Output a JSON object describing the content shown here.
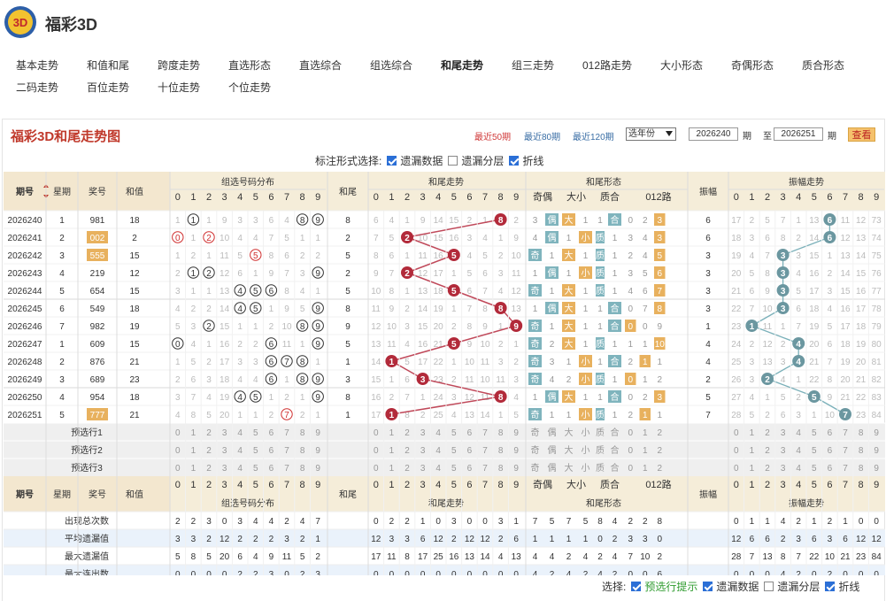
{
  "site": {
    "title": "福彩3D"
  },
  "nav": {
    "row1": [
      "基本走势",
      "和值和尾",
      "跨度走势",
      "直选形态",
      "直选综合",
      "组选综合",
      "和尾走势",
      "组三走势",
      "012路走势",
      "大小形态",
      "奇偶形态",
      "质合形态"
    ],
    "row2": [
      "二码走势",
      "百位走势",
      "十位走势",
      "个位走势"
    ],
    "active": "和尾走势"
  },
  "chart": {
    "title": "福彩3D和尾走势图",
    "ranges": [
      "最近50期",
      "最近80期",
      "最近120期"
    ],
    "selected_range": "最近50期",
    "year_select": "选年份",
    "start_period": "2026240",
    "end_period": "2026251",
    "label_qi": "期",
    "label_zhi": "至",
    "query": "查看"
  },
  "marking": {
    "label": "标注形式选择:",
    "options": [
      {
        "label": "遗漏数据",
        "checked": true
      },
      {
        "label": "遗漏分层",
        "checked": false
      },
      {
        "label": "折线",
        "checked": true
      }
    ]
  },
  "headers": {
    "period": "期号",
    "weekday": "星期",
    "prize": "奖号",
    "sum": "和值",
    "group_dist": "组选号码分布",
    "tail": "和尾",
    "tail_trend": "和尾走势",
    "tail_form": "和尾形态",
    "amp": "振幅",
    "amp_trend": "振幅走势",
    "form_sub": [
      "奇偶",
      "大小",
      "质合",
      "012路"
    ],
    "digits": [
      "0",
      "1",
      "2",
      "3",
      "4",
      "5",
      "6",
      "7",
      "8",
      "9"
    ]
  },
  "rows": [
    {
      "p": "2026240",
      "w": "1",
      "n": "981",
      "s": "18",
      "hit": false,
      "dist": [
        "1",
        "①",
        "1",
        "9",
        "3",
        "3",
        "6",
        "4",
        "⑧",
        "⑨"
      ],
      "t": "8",
      "tt": [
        "6",
        "4",
        "1",
        "9",
        "14",
        "15",
        "2",
        "1",
        "8",
        "2"
      ],
      "oe": [
        "3",
        "偶"
      ],
      "bs": [
        "大",
        "1"
      ],
      "pc": [
        "1",
        "合"
      ],
      "r012": [
        "0",
        "2",
        "3",
        "2"
      ],
      "a": "6",
      "at": [
        "17",
        "2",
        "5",
        "7",
        "1",
        "13",
        "6",
        "11",
        "12",
        "73"
      ]
    },
    {
      "p": "2026241",
      "w": "2",
      "n": "002",
      "s": "2",
      "hit": true,
      "dist": [
        "⓪",
        "1",
        "②",
        "10",
        "4",
        "4",
        "7",
        "5",
        "1",
        "1"
      ],
      "t": "2",
      "tt": [
        "7",
        "5",
        "2",
        "10",
        "15",
        "16",
        "3",
        "4",
        "1",
        "9"
      ],
      "oe": [
        "4",
        "偶"
      ],
      "bs": [
        "1",
        "小"
      ],
      "pc": [
        "质",
        "1"
      ],
      "r012": [
        "3",
        "4",
        "3",
        "2"
      ],
      "a": "6",
      "at": [
        "18",
        "3",
        "6",
        "8",
        "2",
        "14",
        "6",
        "12",
        "13",
        "74"
      ]
    },
    {
      "p": "2026242",
      "w": "3",
      "n": "555",
      "s": "15",
      "hit": true,
      "dist": [
        "1",
        "2",
        "1",
        "11",
        "5",
        "⑤",
        "8",
        "6",
        "2",
        "2"
      ],
      "t": "5",
      "tt": [
        "8",
        "6",
        "1",
        "11",
        "16",
        "5",
        "4",
        "5",
        "2",
        "10"
      ],
      "oe": [
        "奇",
        "1"
      ],
      "bs": [
        "大",
        "1"
      ],
      "pc": [
        "质",
        "1"
      ],
      "r012": [
        "2",
        "4",
        "5",
        "2"
      ],
      "a": "3",
      "at": [
        "19",
        "4",
        "7",
        "3",
        "3",
        "15",
        "1",
        "13",
        "14",
        "75"
      ]
    },
    {
      "p": "2026243",
      "w": "4",
      "n": "219",
      "s": "12",
      "hit": false,
      "dist": [
        "2",
        "①",
        "②",
        "12",
        "6",
        "1",
        "9",
        "7",
        "3",
        "⑨"
      ],
      "t": "2",
      "tt": [
        "9",
        "7",
        "2",
        "12",
        "17",
        "1",
        "5",
        "6",
        "3",
        "11"
      ],
      "oe": [
        "1",
        "偶"
      ],
      "bs": [
        "1",
        "小"
      ],
      "pc": [
        "质",
        "1"
      ],
      "r012": [
        "3",
        "5",
        "6",
        "2"
      ],
      "a": "3",
      "at": [
        "20",
        "5",
        "8",
        "3",
        "4",
        "16",
        "2",
        "14",
        "15",
        "76"
      ]
    },
    {
      "p": "2026244",
      "w": "5",
      "n": "654",
      "s": "15",
      "hit": false,
      "dist": [
        "3",
        "1",
        "1",
        "13",
        "④",
        "⑤",
        "⑥",
        "8",
        "4",
        "1"
      ],
      "t": "5",
      "tt": [
        "10",
        "8",
        "1",
        "13",
        "18",
        "5",
        "6",
        "7",
        "4",
        "12"
      ],
      "oe": [
        "奇",
        "1"
      ],
      "bs": [
        "大",
        "1"
      ],
      "pc": [
        "质",
        "1"
      ],
      "r012": [
        "4",
        "6",
        "7",
        "2"
      ],
      "a": "3",
      "at": [
        "21",
        "6",
        "9",
        "3",
        "5",
        "17",
        "3",
        "15",
        "16",
        "77"
      ]
    },
    {
      "p": "2026245",
      "w": "6",
      "n": "549",
      "s": "18",
      "hit": false,
      "dist": [
        "4",
        "2",
        "2",
        "14",
        "④",
        "⑤",
        "1",
        "9",
        "5",
        "⑨"
      ],
      "t": "8",
      "tt": [
        "11",
        "9",
        "2",
        "14",
        "19",
        "1",
        "7",
        "8",
        "8",
        "13"
      ],
      "oe": [
        "1",
        "偶"
      ],
      "bs": [
        "大",
        "1"
      ],
      "pc": [
        "1",
        "合"
      ],
      "r012": [
        "0",
        "7",
        "8",
        "2"
      ],
      "a": "3",
      "at": [
        "22",
        "7",
        "10",
        "3",
        "6",
        "18",
        "4",
        "16",
        "17",
        "78"
      ]
    },
    {
      "p": "2026246",
      "w": "7",
      "n": "982",
      "s": "19",
      "hit": false,
      "dist": [
        "5",
        "3",
        "②",
        "15",
        "1",
        "1",
        "2",
        "10",
        "⑧",
        "⑨"
      ],
      "t": "9",
      "tt": [
        "12",
        "10",
        "3",
        "15",
        "20",
        "2",
        "8",
        "9",
        "1",
        "9"
      ],
      "oe": [
        "奇",
        "1"
      ],
      "bs": [
        "大",
        "1"
      ],
      "pc": [
        "1",
        "合"
      ],
      "r012": [
        "0",
        "0",
        "9",
        "1"
      ],
      "a": "1",
      "at": [
        "23",
        "1",
        "11",
        "1",
        "7",
        "19",
        "5",
        "17",
        "18",
        "79"
      ]
    },
    {
      "p": "2026247",
      "w": "1",
      "n": "609",
      "s": "15",
      "hit": false,
      "dist": [
        "⓪",
        "4",
        "1",
        "16",
        "2",
        "2",
        "⑥",
        "11",
        "1",
        "⑨"
      ],
      "t": "5",
      "tt": [
        "13",
        "11",
        "4",
        "16",
        "21",
        "5",
        "9",
        "10",
        "2",
        "1"
      ],
      "oe": [
        "奇",
        "2"
      ],
      "bs": [
        "大",
        "1"
      ],
      "pc": [
        "质",
        "1"
      ],
      "r012": [
        "1",
        "1",
        "10",
        "2"
      ],
      "a": "4",
      "at": [
        "24",
        "2",
        "12",
        "2",
        "4",
        "20",
        "6",
        "18",
        "19",
        "80"
      ]
    },
    {
      "p": "2026248",
      "w": "2",
      "n": "876",
      "s": "21",
      "hit": false,
      "dist": [
        "1",
        "5",
        "2",
        "17",
        "3",
        "3",
        "⑥",
        "⑦",
        "⑧",
        "1"
      ],
      "t": "1",
      "tt": [
        "14",
        "1",
        "5",
        "17",
        "22",
        "1",
        "10",
        "11",
        "3",
        "2"
      ],
      "oe": [
        "奇",
        "3"
      ],
      "bs": [
        "1",
        "小"
      ],
      "pc": [
        "1",
        "合"
      ],
      "r012": [
        "2",
        "1",
        "1",
        "3"
      ],
      "a": "4",
      "at": [
        "25",
        "3",
        "13",
        "3",
        "4",
        "21",
        "7",
        "19",
        "20",
        "81"
      ]
    },
    {
      "p": "2026249",
      "w": "3",
      "n": "689",
      "s": "23",
      "hit": false,
      "dist": [
        "2",
        "6",
        "3",
        "18",
        "4",
        "4",
        "⑥",
        "1",
        "⑧",
        "⑨"
      ],
      "t": "3",
      "tt": [
        "15",
        "1",
        "6",
        "3",
        "23",
        "2",
        "11",
        "10",
        "11",
        "3"
      ],
      "oe": [
        "奇",
        "4"
      ],
      "bs": [
        "2",
        "小"
      ],
      "pc": [
        "质",
        "1"
      ],
      "r012": [
        "0",
        "1",
        "2",
        "4"
      ],
      "a": "2",
      "at": [
        "26",
        "3",
        "2",
        "4",
        "1",
        "22",
        "8",
        "20",
        "21",
        "82"
      ]
    },
    {
      "p": "2026250",
      "w": "4",
      "n": "954",
      "s": "18",
      "hit": false,
      "dist": [
        "3",
        "7",
        "4",
        "19",
        "④",
        "⑤",
        "1",
        "2",
        "1",
        "⑨"
      ],
      "t": "8",
      "tt": [
        "16",
        "2",
        "7",
        "1",
        "24",
        "3",
        "12",
        "11",
        "8",
        "4"
      ],
      "oe": [
        "1",
        "偶"
      ],
      "bs": [
        "大",
        "1"
      ],
      "pc": [
        "1",
        "合"
      ],
      "r012": [
        "0",
        "2",
        "3",
        "5"
      ],
      "a": "5",
      "at": [
        "27",
        "4",
        "1",
        "5",
        "2",
        "5",
        "9",
        "21",
        "22",
        "83"
      ]
    },
    {
      "p": "2026251",
      "w": "5",
      "n": "777",
      "s": "21",
      "hit": true,
      "dist": [
        "4",
        "8",
        "5",
        "20",
        "1",
        "1",
        "2",
        "⑦",
        "2",
        "1"
      ],
      "t": "1",
      "tt": [
        "17",
        "1",
        "8",
        "2",
        "25",
        "4",
        "13",
        "14",
        "1",
        "5"
      ],
      "oe": [
        "奇",
        "1"
      ],
      "bs": [
        "1",
        "小"
      ],
      "pc": [
        "质",
        "1"
      ],
      "r012": [
        "2",
        "1",
        "1",
        "2"
      ],
      "a": "7",
      "at": [
        "28",
        "5",
        "2",
        "6",
        "3",
        "1",
        "10",
        "7",
        "23",
        "84"
      ]
    }
  ],
  "pick_rows": [
    "预选行1",
    "预选行2",
    "预选行3"
  ],
  "pick_form": [
    "奇",
    "偶",
    "大",
    "小",
    "质",
    "合",
    "0",
    "1",
    "2"
  ],
  "stats": [
    {
      "label": "出现总次数",
      "dist": [
        "2",
        "2",
        "3",
        "0",
        "3",
        "4",
        "4",
        "2",
        "4",
        "7"
      ],
      "tail": [
        "0",
        "2",
        "2",
        "1",
        "0",
        "3",
        "0",
        "0",
        "3",
        "1"
      ],
      "form": [
        "7",
        "5",
        "7",
        "5",
        "8",
        "4",
        "2",
        "2",
        "8"
      ],
      "amp": [
        "0",
        "1",
        "1",
        "4",
        "2",
        "1",
        "2",
        "1",
        "0",
        "0"
      ]
    },
    {
      "label": "平均遗漏值",
      "dist": [
        "3",
        "3",
        "2",
        "12",
        "2",
        "2",
        "2",
        "3",
        "2",
        "1"
      ],
      "tail": [
        "12",
        "3",
        "3",
        "6",
        "12",
        "2",
        "12",
        "12",
        "2",
        "6"
      ],
      "form": [
        "1",
        "1",
        "1",
        "1",
        "0",
        "2",
        "3",
        "3",
        "0"
      ],
      "amp": [
        "12",
        "6",
        "6",
        "2",
        "3",
        "6",
        "3",
        "6",
        "12",
        "12"
      ]
    },
    {
      "label": "最大遗漏值",
      "dist": [
        "5",
        "8",
        "5",
        "20",
        "6",
        "4",
        "9",
        "11",
        "5",
        "2"
      ],
      "tail": [
        "17",
        "11",
        "8",
        "17",
        "25",
        "16",
        "13",
        "14",
        "4",
        "13"
      ],
      "form": [
        "4",
        "4",
        "2",
        "4",
        "2",
        "4",
        "7",
        "10",
        "2"
      ],
      "amp": [
        "28",
        "7",
        "13",
        "8",
        "7",
        "22",
        "10",
        "21",
        "23",
        "84"
      ]
    },
    {
      "label": "最大连出数",
      "dist": [
        "0",
        "0",
        "0",
        "0",
        "2",
        "2",
        "3",
        "0",
        "2",
        "3"
      ],
      "tail": [
        "0",
        "0",
        "0",
        "0",
        "0",
        "0",
        "0",
        "0",
        "0",
        "0"
      ],
      "form": [
        "4",
        "2",
        "4",
        "2",
        "4",
        "2",
        "0",
        "0",
        "6"
      ],
      "amp": [
        "0",
        "0",
        "0",
        "4",
        "2",
        "0",
        "2",
        "0",
        "0",
        "0"
      ]
    }
  ],
  "bottom": {
    "label": "选择:",
    "options": [
      {
        "label": "预选行提示",
        "checked": true,
        "color": "#2e9b2e"
      },
      {
        "label": "遗漏数据",
        "checked": true
      },
      {
        "label": "遗漏分层",
        "checked": false
      },
      {
        "label": "折线",
        "checked": true
      }
    ]
  },
  "colors": {
    "red_ball": "#b22a3a",
    "teal_ball": "#6b97a0",
    "orange": "#e8b15e",
    "teal_box": "#7fb4bd",
    "header_bg": "#f5edd9",
    "line_red": "#c0495a",
    "line_teal": "#7ab0b9"
  }
}
